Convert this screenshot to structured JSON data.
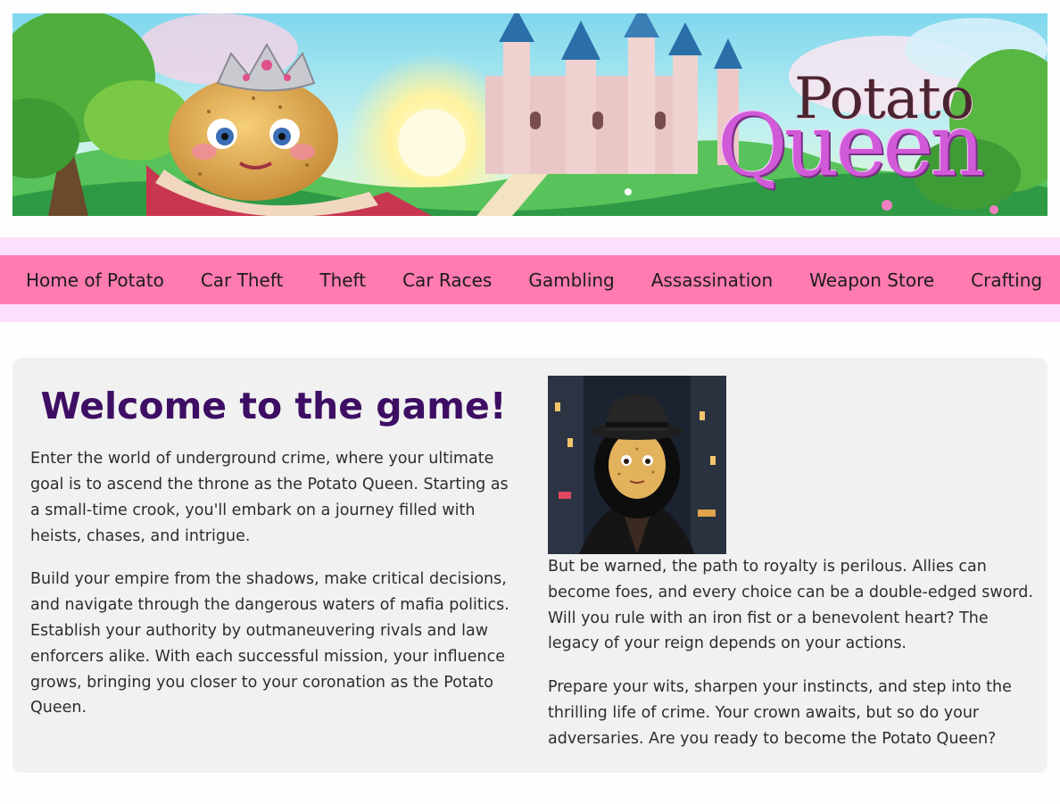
{
  "banner": {
    "logo_line1": "Potato",
    "logo_line2": "Queen"
  },
  "nav": {
    "items": [
      {
        "label": "Home of Potato"
      },
      {
        "label": "Car Theft"
      },
      {
        "label": "Theft"
      },
      {
        "label": "Car Races"
      },
      {
        "label": "Gambling"
      },
      {
        "label": "Assassination"
      },
      {
        "label": "Weapon Store"
      },
      {
        "label": "Crafting"
      }
    ]
  },
  "main": {
    "title": "Welcome to the game!",
    "left_paragraphs": [
      "Enter the world of underground crime, where your ultimate goal is to ascend the throne as the Potato Queen. Starting as a small-time crook, you'll embark on a journey filled with heists, chases, and intrigue.",
      "Build your empire from the shadows, make critical decisions, and navigate through the dangerous waters of mafia politics. Establish your authority by outmaneuvering rivals and law enforcers alike. With each successful mission, your influence grows, bringing you closer to your coronation as the Potato Queen."
    ],
    "right_paragraphs": [
      "But be warned, the path to royalty is perilous. Allies can become foes, and every choice can be a double-edged sword. Will you rule with an iron fist or a benevolent heart? The legacy of your reign depends on your actions.",
      "Prepare your wits, sharpen your instincts, and step into the thrilling life of crime. Your crown awaits, but so do your adversaries. Are you ready to become the Potato Queen?"
    ]
  },
  "colors": {
    "nav_bg": "#ff7bb0",
    "nav_band": "#fce0fb",
    "title": "#3d0e63",
    "card_bg": "#f1f1f1"
  }
}
